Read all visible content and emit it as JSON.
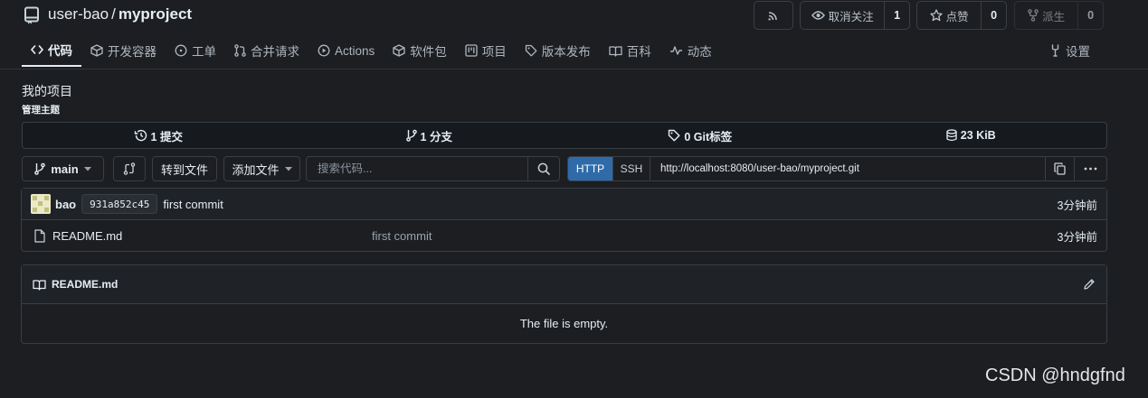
{
  "repo": {
    "owner": "user-bao",
    "separator": "/",
    "name": "myproject"
  },
  "header_buttons": {
    "rss_icon": "rss-icon",
    "watch": {
      "label": "取消关注",
      "count": "1"
    },
    "star": {
      "label": "点赞",
      "count": "0"
    },
    "fork": {
      "label": "派生",
      "count": "0"
    }
  },
  "tabs": [
    {
      "label": "代码",
      "icon": "code-icon",
      "active": true
    },
    {
      "label": "开发容器",
      "icon": "package-icon"
    },
    {
      "label": "工单",
      "icon": "issue-icon"
    },
    {
      "label": "合并请求",
      "icon": "pull-request-icon"
    },
    {
      "label": "Actions",
      "icon": "play-icon"
    },
    {
      "label": "软件包",
      "icon": "package-icon"
    },
    {
      "label": "项目",
      "icon": "project-icon"
    },
    {
      "label": "版本发布",
      "icon": "tag-icon"
    },
    {
      "label": "百科",
      "icon": "book-icon"
    },
    {
      "label": "动态",
      "icon": "pulse-icon"
    }
  ],
  "settings_tab": {
    "label": "设置",
    "icon": "tools-icon"
  },
  "description": "我的项目",
  "manage_topics": "管理主题",
  "stats": {
    "commits": "1 提交",
    "branches": "1 分支",
    "tags": "0 Git标签",
    "size": "23 KiB"
  },
  "actions": {
    "branch": "main",
    "goto_file": "转到文件",
    "add_file": "添加文件",
    "search_placeholder": "搜索代码...",
    "clone_http": "HTTP",
    "clone_ssh": "SSH",
    "clone_url": "http://localhost:8080/user-bao/myproject.git"
  },
  "latest_commit": {
    "author": "bao",
    "sha": "931a852c45",
    "message": "first commit",
    "time": "3分钟前"
  },
  "files": [
    {
      "name": "README.md",
      "message": "first commit",
      "time": "3分钟前"
    }
  ],
  "readme": {
    "title": "README.md",
    "body": "The file is empty."
  },
  "watermark": "CSDN @hndgfnd"
}
